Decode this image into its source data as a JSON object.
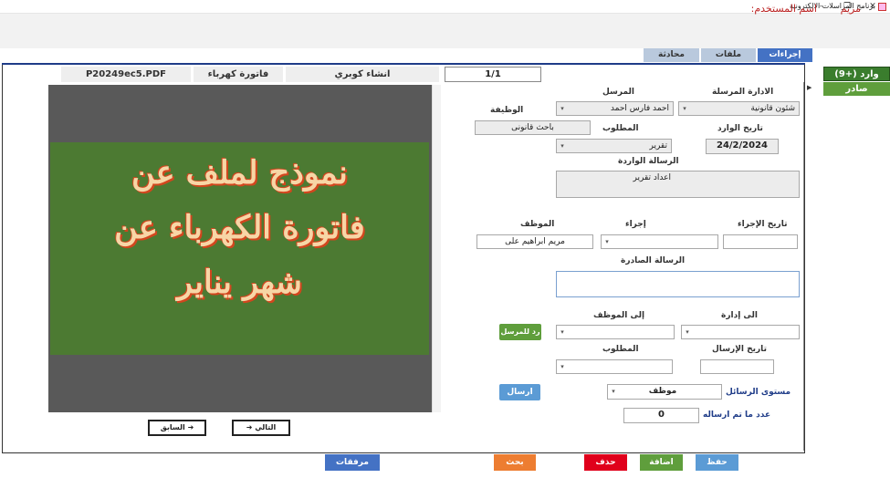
{
  "window": {
    "title": "برنامج المراسلات الالكترونية",
    "min_label": "–",
    "restore_label": "❐",
    "close_label": "✕"
  },
  "header": {
    "user_label": "اسم المستخدم:",
    "user_name": "مريم"
  },
  "tabs": [
    {
      "label": "إجراءات",
      "active": true
    },
    {
      "label": "ملفات",
      "active": false
    },
    {
      "label": "محادثة",
      "active": false
    }
  ],
  "file_header": {
    "file_name": "P20249ec5.PDF",
    "file_title": "فاتورة كهرباء",
    "project": "انشاء كوبري",
    "pager": "1/1"
  },
  "document": {
    "line1": "نموذج لملف عن",
    "line2": "فاتورة الكهرباء عن",
    "line3": "شهر يناير"
  },
  "nav": {
    "prev_label": "السابق ➜",
    "next_label": "➜ التالي"
  },
  "form": {
    "sender_dept_label": "الادارة المرسلة",
    "sender_dept_value": "شئون قانونية",
    "sender_label": "المرسل",
    "sender_value": "احمد فارس احمد",
    "job_label": "الوظيفة",
    "job_value": "باحث قانونى",
    "incoming_date_label": "تاريخ الوارد",
    "incoming_date_value": "24/2/2024",
    "required_label": "المطلوب",
    "required_value": "تقرير",
    "incoming_msg_label": "الرسالة الواردة",
    "incoming_msg_value": "اعداد تقرير",
    "action_date_label": "تاريخ الإجراء",
    "action_date_value": "",
    "action_label": "إجراء",
    "action_value": "",
    "employee_label": "الموظف",
    "employee_value": "مريم ابراهيم على",
    "outgoing_msg_label": "الرسالة الصادرة",
    "outgoing_msg_value": "",
    "to_dept_label": "الى إدارة",
    "to_employee_label": "إلى الموظف",
    "reply_button": "رد للمرسل",
    "send_date_label": "تاريخ الإرسال",
    "required2_label": "المطلوب",
    "level_label": "مستوى الرسائل",
    "level_value": "موظف",
    "send_button": "ارسال",
    "sent_count_label": "عدد ما تم ارساله",
    "sent_count_value": "0"
  },
  "side": {
    "inbox_label": "وارد (+9)",
    "outbox_label": "صادر"
  },
  "bottom": {
    "attachments": "مرفقات",
    "search": "بحث",
    "delete": "حذف",
    "add": "اضافة",
    "save": "حفظ"
  },
  "colors": {
    "accent": "#4472c4",
    "green": "#5f9e3c",
    "dark_green": "#3a7d2d",
    "orange": "#ed7d31",
    "red": "#e0001b",
    "blue": "#5b9bd5",
    "user_text": "#b22222"
  },
  "icons": {
    "caret": "chevron-down-icon",
    "arrow": "arrow-right-icon"
  }
}
